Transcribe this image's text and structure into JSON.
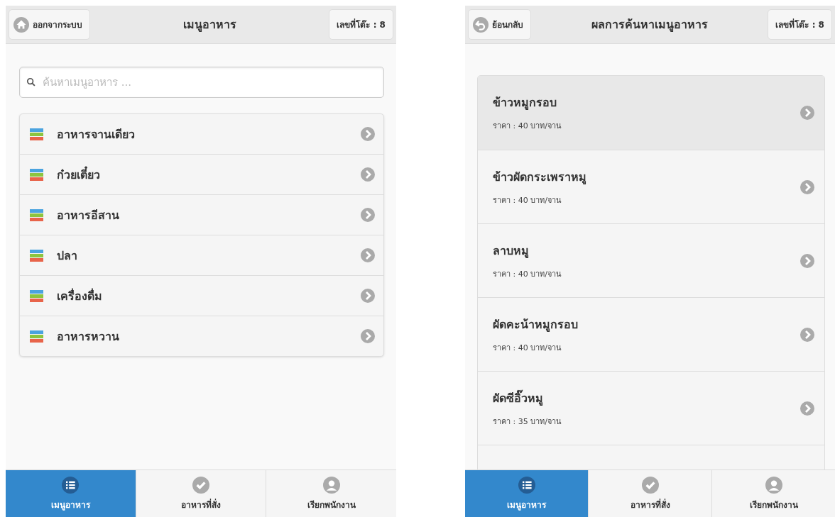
{
  "screens": [
    {
      "kind": "categories",
      "header": {
        "left_button": {
          "label": "ออกจากระบบ"
        },
        "title": "เมนูอาหาร",
        "table_badge": "เลขที่โต๊ะ : 8"
      },
      "search": {
        "placeholder": "ค้นหาเมนูอาหาร ..."
      },
      "categories": [
        {
          "label": "อาหารจานเดียว"
        },
        {
          "label": "ก๋วยเตี๋ยว"
        },
        {
          "label": "อาหารอีสาน"
        },
        {
          "label": "ปลา"
        },
        {
          "label": "เครื่องดื่ม"
        },
        {
          "label": "อาหารหวาน"
        }
      ],
      "tab_bar": [
        {
          "label": "เมนูอาหาร",
          "selected": true
        },
        {
          "label": "อาหารที่สั่ง",
          "selected": false
        },
        {
          "label": "เรียกพนักงาน",
          "selected": false
        }
      ]
    },
    {
      "kind": "results",
      "header": {
        "left_button": {
          "label": "ย้อนกลับ"
        },
        "title": "ผลการค้นหาเมนูอาหาร",
        "table_badge": "เลขที่โต๊ะ : 8"
      },
      "results": [
        {
          "name": "ข้าวหมูกรอบ",
          "price": "ราคา : 40 บาท/จาน",
          "selected": true
        },
        {
          "name": "ข้าวผัดกระเพราหมู",
          "price": "ราคา : 40 บาท/จาน",
          "selected": false
        },
        {
          "name": "ลาบหมู",
          "price": "ราคา : 40 บาท/จาน",
          "selected": false
        },
        {
          "name": "ผัดคะน้าหมูกรอบ",
          "price": "ราคา : 40 บาท/จาน",
          "selected": false
        },
        {
          "name": "ผัดซีอิ๊วหมู",
          "price": "ราคา : 35 บาท/จาน",
          "selected": false
        }
      ],
      "tab_bar": [
        {
          "label": "เมนูอาหาร",
          "selected": true
        },
        {
          "label": "อาหารที่สั่ง",
          "selected": false
        },
        {
          "label": "เรียกพนักงาน",
          "selected": false
        }
      ]
    }
  ]
}
